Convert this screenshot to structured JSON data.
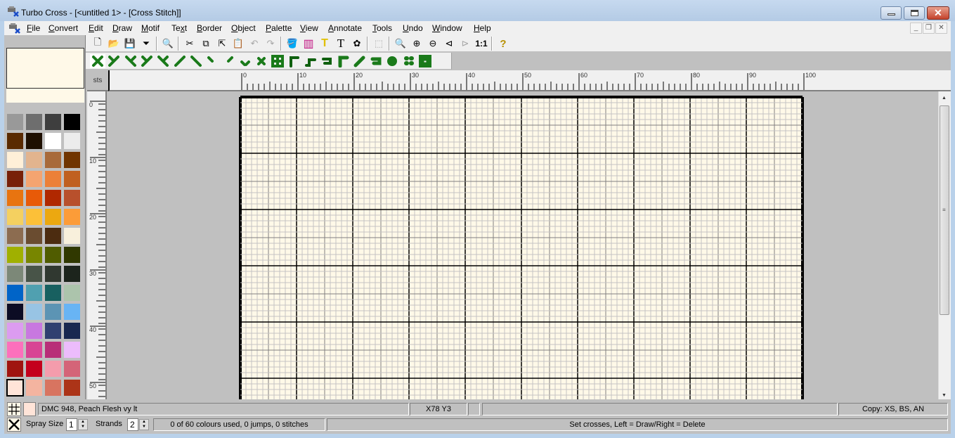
{
  "window": {
    "title": "Turbo Cross - [<untitled 1> - [Cross Stitch]]",
    "controls": [
      "minimize",
      "maximize",
      "close"
    ],
    "mdi_controls": [
      "minimize",
      "restore",
      "close"
    ]
  },
  "menu": [
    {
      "label": "File",
      "u": "F"
    },
    {
      "label": "Convert",
      "u": "C"
    },
    {
      "label": "Edit",
      "u": "E"
    },
    {
      "label": "Draw",
      "u": "D"
    },
    {
      "label": "Motif",
      "u": "M"
    },
    {
      "label": "Text",
      "u": "x"
    },
    {
      "label": "Border",
      "u": "B"
    },
    {
      "label": "Object",
      "u": "O"
    },
    {
      "label": "Palette",
      "u": "P"
    },
    {
      "label": "View",
      "u": "V"
    },
    {
      "label": "Annotate",
      "u": "A"
    },
    {
      "label": "Tools",
      "u": "T"
    },
    {
      "label": "Undo",
      "u": "U"
    },
    {
      "label": "Window",
      "u": "W"
    },
    {
      "label": "Help",
      "u": "H"
    }
  ],
  "toolbar1": [
    {
      "name": "new-icon",
      "glyph": "🗋"
    },
    {
      "name": "open-icon",
      "glyph": "📂"
    },
    {
      "name": "save-icon",
      "glyph": "💾"
    },
    {
      "name": "funnel-icon",
      "glyph": "⏷"
    },
    {
      "sep": true
    },
    {
      "name": "print-preview-icon",
      "glyph": "🔍"
    },
    {
      "sep": true
    },
    {
      "name": "cut-icon",
      "glyph": "✂"
    },
    {
      "name": "copy-icon",
      "glyph": "⧉"
    },
    {
      "name": "copy-to-icon",
      "glyph": "⇱"
    },
    {
      "name": "paste-icon",
      "glyph": "📋"
    },
    {
      "name": "undo-icon",
      "glyph": "↶"
    },
    {
      "name": "redo-icon",
      "glyph": "↷"
    },
    {
      "sep": true
    },
    {
      "name": "fill-icon",
      "glyph": "🪣"
    },
    {
      "name": "color-bars-icon",
      "glyph": "▥"
    },
    {
      "name": "text-yellow-icon",
      "glyph": "T"
    },
    {
      "name": "text-icon",
      "glyph": "T"
    },
    {
      "name": "motif-icon",
      "glyph": "✿"
    },
    {
      "sep": true
    },
    {
      "name": "select-rect-icon",
      "glyph": "⬚"
    },
    {
      "sep": true
    },
    {
      "name": "zoom-icon",
      "glyph": "🔍"
    },
    {
      "name": "zoom-in-icon",
      "glyph": "⊕"
    },
    {
      "name": "zoom-out-icon",
      "glyph": "⊖"
    },
    {
      "name": "zoom-back-icon",
      "glyph": "⊲"
    },
    {
      "name": "zoom-fwd-icon",
      "glyph": "⊳"
    },
    {
      "name": "zoom-1to1-icon",
      "glyph": "1:1"
    },
    {
      "sep": true
    },
    {
      "name": "help-icon",
      "glyph": "?"
    }
  ],
  "toolbar2": [
    "full-cross-icon",
    "half-cross-tr-icon",
    "half-cross-tl-icon",
    "three-quarter-bl-icon",
    "three-quarter-br-icon",
    "half-stitch-up-icon",
    "half-stitch-down-icon",
    "quarter-tl-icon",
    "quarter-tr-icon",
    "quarter-pair-icon",
    "petite-cross-icon",
    "cross-box-icon",
    "backstitch-corner-icon",
    "backstitch-step-icon",
    "backstitch-loop-icon",
    "thick-corner-icon",
    "thick-step-icon",
    "thick-loop-icon",
    "french-knot-icon",
    "four-dots-icon",
    "long-stitch-icon"
  ],
  "ruler": {
    "corner_label": "sts",
    "h_labels": [
      "0",
      "10",
      "20",
      "30",
      "40",
      "50",
      "60",
      "70",
      "80",
      "90",
      "100"
    ],
    "v_labels": [
      "0",
      "10",
      "20",
      "30",
      "40",
      "50"
    ]
  },
  "palette": [
    "#999999",
    "#6e6e6e",
    "#3e3e3e",
    "#000000",
    "#5a2a00",
    "#1e0f00",
    "#ffffff",
    "#ececec",
    "#fff0d8",
    "#e2b48e",
    "#a86a3a",
    "#703400",
    "#782008",
    "#f4a470",
    "#ec8038",
    "#c06020",
    "#e87410",
    "#e85a08",
    "#b02800",
    "#b8502c",
    "#f4d060",
    "#fcc038",
    "#eca810",
    "#fc9c38",
    "#8c6c50",
    "#6a4c30",
    "#4c2c10",
    "#f8f0dc",
    "#a0b000",
    "#788600",
    "#505c00",
    "#303800",
    "#7c8878",
    "#485448",
    "#303830",
    "#1c241c",
    "#0064c8",
    "#50a0b0",
    "#186060",
    "#acc4ac",
    "#0c0c24",
    "#98c4e4",
    "#5c94b4",
    "#68b4f4",
    "#dc9cf0",
    "#c878e0",
    "#304070",
    "#182850",
    "#fc70bc",
    "#d84494",
    "#b82e78",
    "#ecbcfc",
    "#a01410",
    "#c4001c",
    "#f49cac",
    "#d46478",
    "#ffe4d8",
    "#f4b4a0",
    "#d87460",
    "#ac3418"
  ],
  "selected_color_index": 56,
  "status": {
    "color_name": "DMC 948, Peach Flesh vy lt",
    "color_swatch": "#ffe4d8",
    "coords": "X78 Y3",
    "copy": "Copy: XS, BS, AN",
    "spray_label": "Spray Size",
    "spray_value": "1",
    "strands_label": "Strands",
    "strands_value": "2",
    "summary": "0 of 60 colours used, 0 jumps, 0 stitches",
    "hint": "Set crosses,  Left = Draw/Right = Delete"
  },
  "grid": {
    "width_stitches": 100,
    "visible_rows": 53,
    "background": "#fff9e8"
  }
}
